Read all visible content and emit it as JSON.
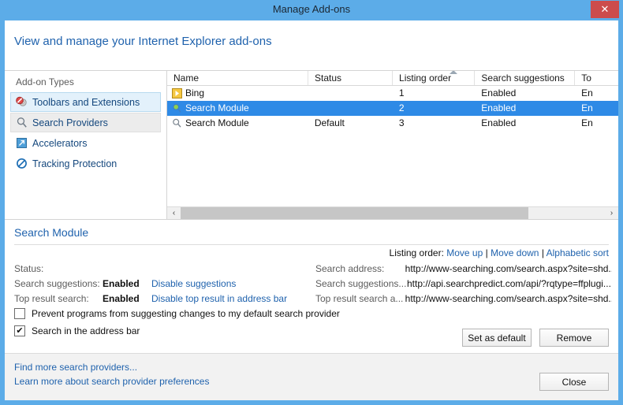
{
  "window": {
    "title": "Manage Add-ons",
    "close_label": "✕",
    "titlebar_color": "#5cace8",
    "close_color": "#cc4c4c"
  },
  "banner": {
    "title": "View and manage your Internet Explorer add-ons"
  },
  "sidebar": {
    "heading": "Add-on Types",
    "items": [
      {
        "label": "Toolbars and Extensions",
        "icon": "toolbars-icon",
        "state": "highlight"
      },
      {
        "label": "Search Providers",
        "icon": "magnifier-icon",
        "state": "current"
      },
      {
        "label": "Accelerators",
        "icon": "accelerator-icon",
        "state": "normal"
      },
      {
        "label": "Tracking Protection",
        "icon": "no-entry-icon",
        "state": "normal"
      }
    ]
  },
  "table": {
    "columns": [
      {
        "key": "name",
        "label": "Name"
      },
      {
        "key": "status",
        "label": "Status"
      },
      {
        "key": "order",
        "label": "Listing order",
        "sorted": true
      },
      {
        "key": "suggestions",
        "label": "Search suggestions"
      },
      {
        "key": "top",
        "label": "To"
      }
    ],
    "rows": [
      {
        "icon": "bing-icon",
        "name": "Bing",
        "status": "",
        "order": "1",
        "suggestions": "Enabled",
        "top": "En",
        "selected": false
      },
      {
        "icon": "magnifier-green-icon",
        "name": "Search Module",
        "status": "",
        "order": "2",
        "suggestions": "Enabled",
        "top": "En",
        "selected": true
      },
      {
        "icon": "magnifier-icon",
        "name": "Search Module",
        "status": "Default",
        "order": "3",
        "suggestions": "Enabled",
        "top": "En",
        "selected": false
      }
    ],
    "scrollbar": {
      "left_arrow": "‹",
      "right_arrow": "›"
    }
  },
  "detail": {
    "title": "Search Module",
    "listing_order": {
      "label": "Listing order:",
      "move_up": "Move up",
      "separator": "|",
      "move_down": "Move down",
      "alphabetic_sort": "Alphabetic sort"
    },
    "info": [
      {
        "label": "Status:",
        "value": "",
        "link": ""
      },
      {
        "label": "Search suggestions:",
        "value": "Enabled",
        "link": "Disable suggestions"
      },
      {
        "label": "Top result search:",
        "value": "Enabled",
        "link": "Disable top result in address bar"
      }
    ],
    "addresses": [
      {
        "label": "Search address:",
        "value": "http://www-searching.com/search.aspx?site=shd..."
      },
      {
        "label": "Search suggestions...",
        "value": "http://api.searchpredict.com/api/?rqtype=ffplugi..."
      },
      {
        "label": "Top result search a...",
        "value": "http://www-searching.com/search.aspx?site=shd..."
      }
    ],
    "checkboxes": [
      {
        "label": "Prevent programs from suggesting changes to my default search provider",
        "checked": false,
        "mark": ""
      },
      {
        "label": "Search in the address bar",
        "checked": true,
        "mark": "✔"
      }
    ],
    "buttons": [
      {
        "label": "Set as default"
      },
      {
        "label": "Remove"
      }
    ]
  },
  "footer": {
    "links": [
      {
        "label": "Find more search providers..."
      },
      {
        "label": "Learn more about search provider preferences"
      }
    ],
    "close_button": "Close"
  }
}
